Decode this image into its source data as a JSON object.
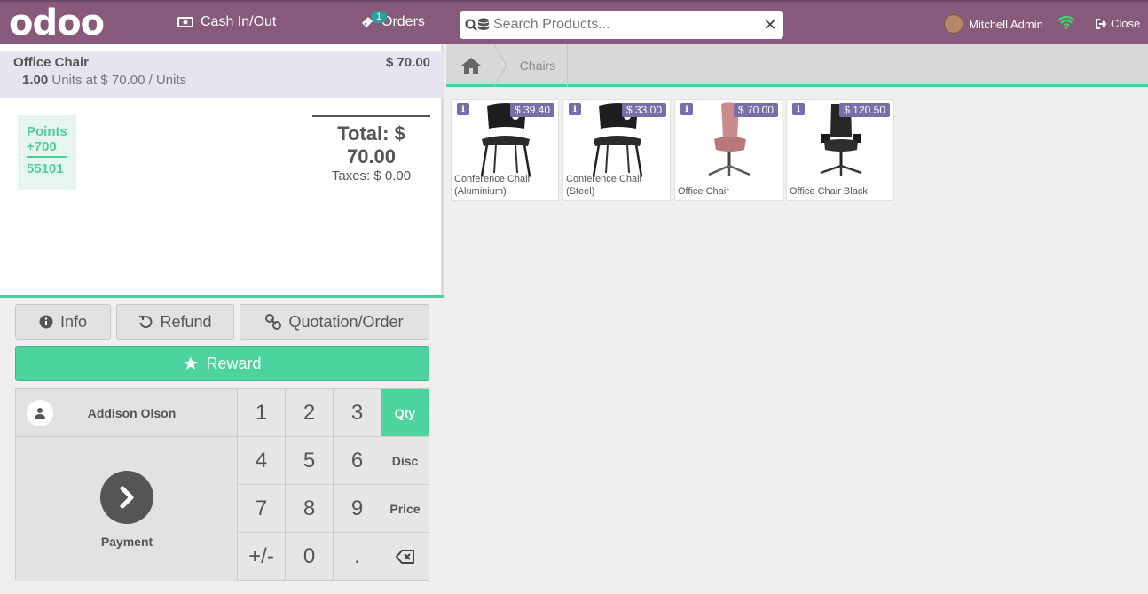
{
  "header": {
    "logo": "odoo",
    "cash_label": "Cash In/Out",
    "orders_label": "Orders",
    "orders_badge": "1",
    "search_placeholder": "Search Products...",
    "user_name": "Mitchell Admin",
    "close_label": "Close"
  },
  "order": {
    "line": {
      "product": "Office Chair",
      "price": "$ 70.00",
      "qty": "1.00",
      "detail": "Units at $ 70.00 / Units"
    },
    "points": {
      "label": "Points",
      "value": "+700",
      "total": "55101"
    },
    "total": "Total: $ 70.00",
    "taxes": "Taxes: $ 0.00"
  },
  "controls": {
    "info": "Info",
    "refund": "Refund",
    "quotation": "Quotation/Order",
    "reward": "Reward",
    "customer": "Addison Olson",
    "payment": "Payment",
    "keys": [
      "1",
      "2",
      "3",
      "Qty",
      "4",
      "5",
      "6",
      "Disc",
      "7",
      "8",
      "9",
      "Price",
      "+/-",
      "0",
      ".",
      ""
    ]
  },
  "breadcrumb": {
    "category": "Chairs"
  },
  "products": [
    {
      "name": "Conference Chair (Aluminium)",
      "price": "$ 39.40"
    },
    {
      "name": "Conference Chair (Steel)",
      "price": "$ 33.00"
    },
    {
      "name": "Office Chair",
      "price": "$ 70.00"
    },
    {
      "name": "Office Chair Black",
      "price": "$ 120.50"
    }
  ],
  "colors": {
    "header": "#875a7b",
    "accent": "#4cd39e",
    "price_badge": "#7a6ea8"
  }
}
